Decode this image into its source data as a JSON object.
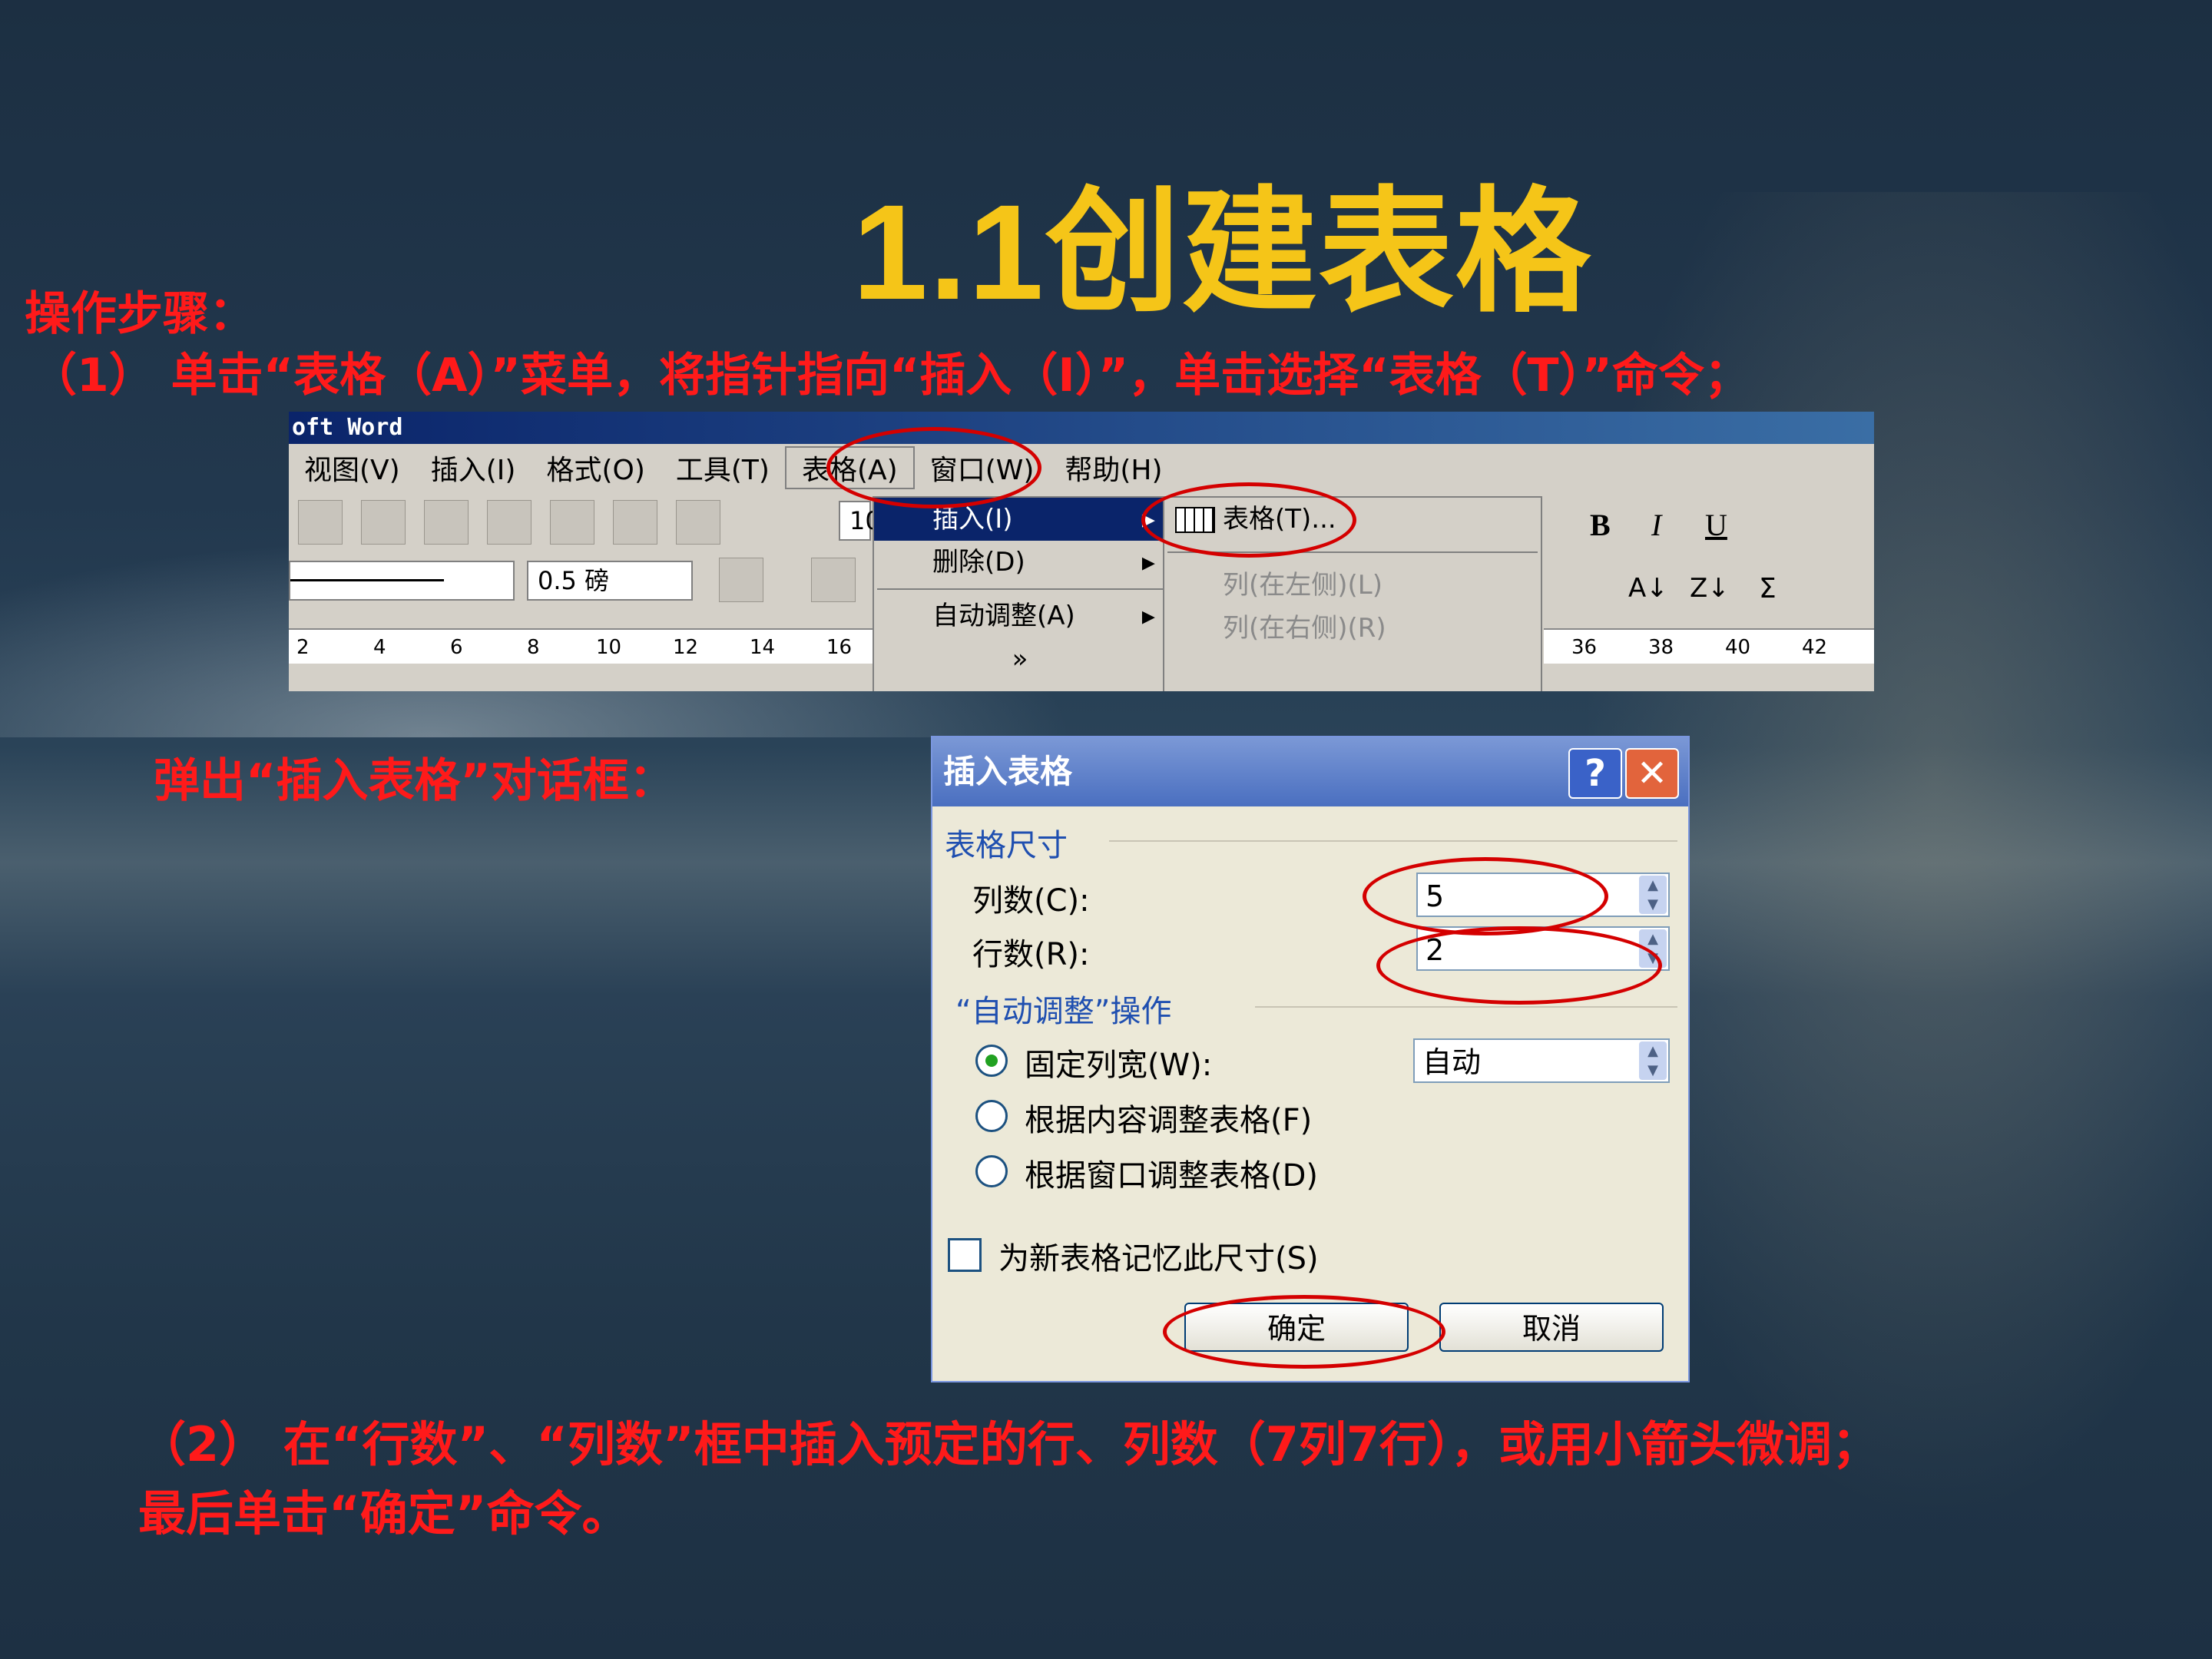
{
  "slide": {
    "title": "1.1创建表格",
    "steps_label": "操作步骤：",
    "step1": "（1） 单击“表格（A）”菜单，将指针指向“插入（I）”，单击选择“表格（T）”命令；",
    "popup_label": "弹出“插入表格”对话框：",
    "step2_line1": "（2） 在“行数”、“列数”框中插入预定的行、列数（7列7行），或用小箭头微调；",
    "step2_line2": "最后单击“确定”命令。"
  },
  "word": {
    "window_title": "oft Word",
    "menus": [
      "视图(V)",
      "插入(I)",
      "格式(O)",
      "工具(T)",
      "表格(A)",
      "窗口(W)",
      "帮助(H)"
    ],
    "line_weight": "0.5 磅",
    "font_size": "10",
    "ruler_left": [
      "2",
      "4",
      "6",
      "8",
      "10",
      "12",
      "14",
      "16"
    ],
    "ruler_right": [
      "36",
      "38",
      "40",
      "42"
    ],
    "table_menu": [
      {
        "label": "插入(I)",
        "arrow": "▸"
      },
      {
        "label": "删除(D)",
        "arrow": "▸"
      },
      {
        "label": "自动调整(A)",
        "arrow": "▸"
      },
      {
        "label": "»",
        "arrow": ""
      }
    ],
    "insert_submenu": [
      {
        "label": "表格(T)..."
      },
      {
        "label": "列(在左侧)(L)"
      },
      {
        "label": "列(在右侧)(R)"
      }
    ]
  },
  "dialog": {
    "title": "插入表格",
    "help": "?",
    "close": "✕",
    "size_group": "表格尺寸",
    "cols_label": "列数(C):",
    "cols_value": "5",
    "rows_label": "行数(R):",
    "rows_value": "2",
    "autofit_group": "“自动调整”操作",
    "fixed_label": "固定列宽(W):",
    "fixed_value": "自动",
    "content_label": "根据内容调整表格(F)",
    "window_label": "根据窗口调整表格(D)",
    "remember_label": "为新表格记忆此尺寸(S)",
    "ok": "确定",
    "cancel": "取消"
  }
}
